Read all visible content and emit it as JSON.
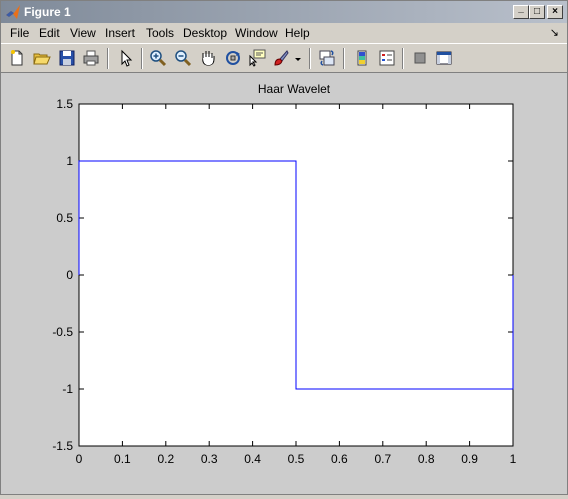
{
  "window": {
    "title": "Figure 1",
    "controls": {
      "minimize": "_",
      "maximize": "□",
      "close": "×"
    }
  },
  "menu": {
    "items": [
      "File",
      "Edit",
      "View",
      "Insert",
      "Tools",
      "Desktop",
      "Window",
      "Help"
    ],
    "dock_glyph": "↘"
  },
  "toolbar": {
    "tools": [
      "new-figure-icon",
      "open-file-icon",
      "save-icon",
      "print-icon",
      "edit-plot-arrow-icon",
      "zoom-in-icon",
      "zoom-out-icon",
      "pan-hand-icon",
      "rotate-3d-icon",
      "data-cursor-icon",
      "brush-icon",
      "link-plot-icon",
      "colorbar-icon",
      "legend-icon",
      "hide-plot-tools-icon",
      "show-plot-tools-icon"
    ]
  },
  "chart_data": {
    "type": "line",
    "title": "Haar Wavelet",
    "xlabel": "",
    "ylabel": "",
    "xlim": [
      0,
      1
    ],
    "ylim": [
      -1.5,
      1.5
    ],
    "xticks": [
      "0",
      "0.1",
      "0.2",
      "0.3",
      "0.4",
      "0.5",
      "0.6",
      "0.7",
      "0.8",
      "0.9",
      "1"
    ],
    "yticks": [
      "-1.5",
      "-1",
      "-0.5",
      "0",
      "0.5",
      "1",
      "1.5"
    ],
    "grid": false,
    "line_color": "#0000ff",
    "series": [
      {
        "x": [
          0,
          0,
          0.5,
          0.5,
          1,
          1
        ],
        "y": [
          0,
          1,
          1,
          -1,
          -1,
          0
        ]
      }
    ]
  }
}
